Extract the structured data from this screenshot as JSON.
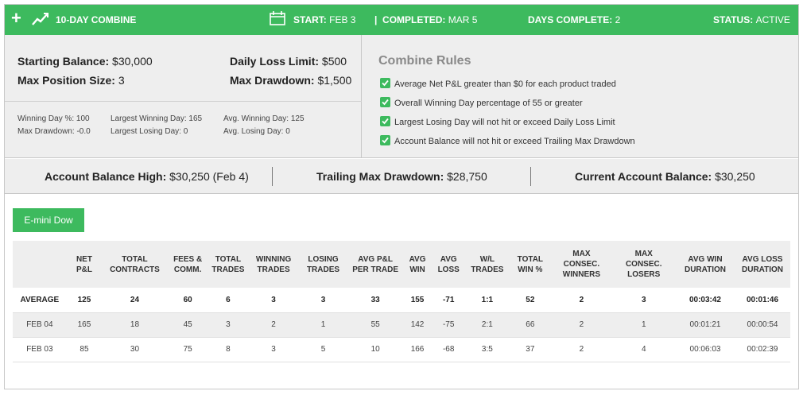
{
  "header": {
    "title": "10-DAY COMBINE",
    "start_label": "START:",
    "start_value": "FEB 3",
    "completed_label": "COMPLETED:",
    "completed_value": "MAR 5",
    "days_label": "DAYS COMPLETE:",
    "days_value": "2",
    "status_label": "STATUS:",
    "status_value": "ACTIVE"
  },
  "account": {
    "starting_balance_label": "Starting Balance:",
    "starting_balance": "$30,000",
    "daily_loss_limit_label": "Daily Loss Limit:",
    "daily_loss_limit": "$500",
    "max_position_label": "Max Position Size:",
    "max_position": "3",
    "max_drawdown_label": "Max Drawdown:",
    "max_drawdown": "$1,500"
  },
  "stats": {
    "winning_day_pct": "Winning Day %: 100",
    "max_drawdown": "Max Drawdown: -0.0",
    "largest_winning_day": "Largest Winning Day: 165",
    "largest_losing_day": "Largest Losing Day: 0",
    "avg_winning_day": "Avg. Winning Day: 125",
    "avg_losing_day": "Avg. Losing Day: 0"
  },
  "rules": {
    "title": "Combine Rules",
    "items": [
      "Average Net P&L greater than $0 for each product traded",
      "Overall Winning Day percentage of 55 or greater",
      "Largest Losing Day will not hit or exceed Daily Loss Limit",
      "Account Balance will not hit or exceed Trailing Max Drawdown"
    ]
  },
  "summary": {
    "high_label": "Account Balance High:",
    "high_value": "$30,250 (Feb 4)",
    "trailing_label": "Trailing Max Drawdown:",
    "trailing_value": "$28,750",
    "current_label": "Current Account Balance:",
    "current_value": "$30,250"
  },
  "product_button": "E-mini Dow",
  "table": {
    "headers": [
      "",
      "NET\nP&L",
      "TOTAL\nCONTRACTS",
      "FEES &\nCOMM.",
      "TOTAL\nTRADES",
      "WINNING\nTRADES",
      "LOSING\nTRADES",
      "AVG P&L\nPER TRADE",
      "AVG\nWIN",
      "AVG\nLOSS",
      "W/L\nTRADES",
      "TOTAL\nWIN %",
      "MAX\nCONSEC.\nWINNERS",
      "MAX\nCONSEC.\nLOSERS",
      "AVG WIN\nDURATION",
      "AVG LOSS\nDURATION"
    ],
    "rows": [
      [
        "AVERAGE",
        "125",
        "24",
        "60",
        "6",
        "3",
        "3",
        "33",
        "155",
        "-71",
        "1:1",
        "52",
        "2",
        "3",
        "00:03:42",
        "00:01:46"
      ],
      [
        "FEB 04",
        "165",
        "18",
        "45",
        "3",
        "2",
        "1",
        "55",
        "142",
        "-75",
        "2:1",
        "66",
        "2",
        "1",
        "00:01:21",
        "00:00:54"
      ],
      [
        "FEB 03",
        "85",
        "30",
        "75",
        "8",
        "3",
        "5",
        "10",
        "166",
        "-68",
        "3:5",
        "37",
        "2",
        "4",
        "00:06:03",
        "00:02:39"
      ]
    ]
  }
}
